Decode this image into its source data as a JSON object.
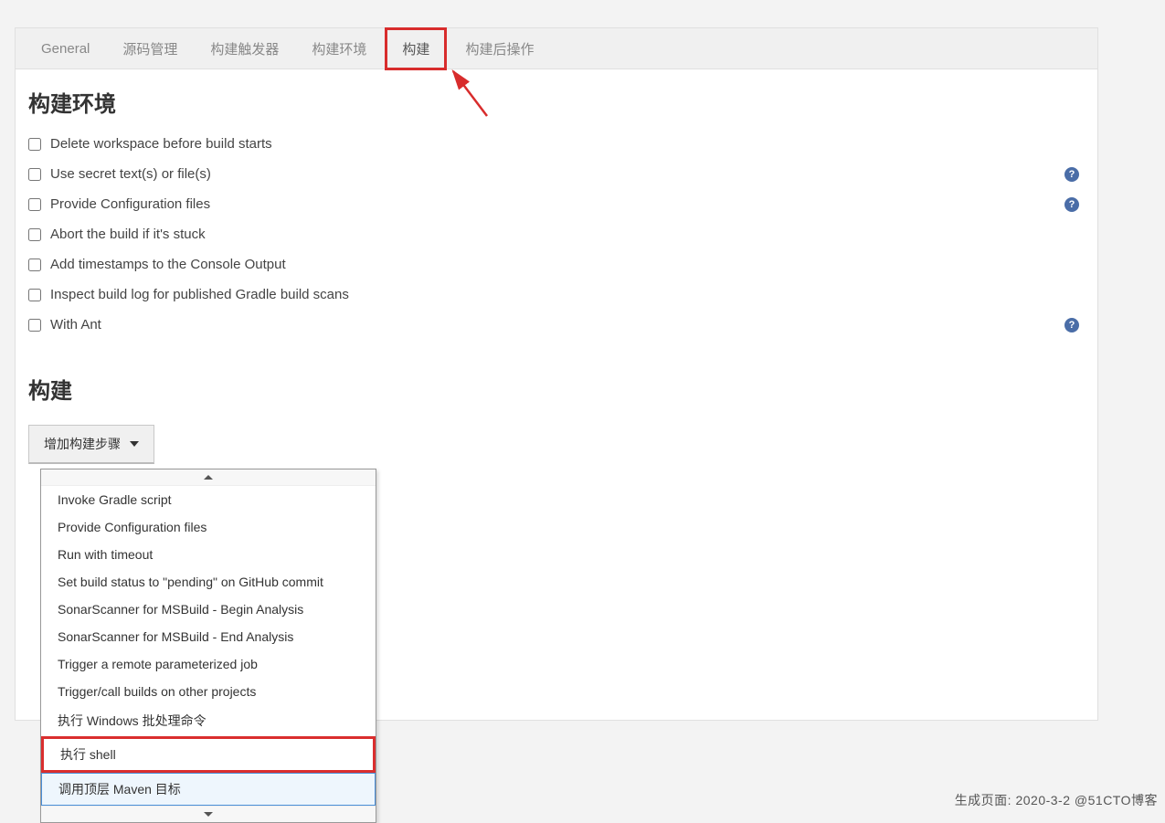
{
  "tabs": [
    "General",
    "源码管理",
    "构建触发器",
    "构建环境",
    "构建",
    "构建后操作"
  ],
  "active_tab_index": 4,
  "section_env": {
    "title": "构建环境",
    "items": [
      {
        "label": "Delete workspace before build starts",
        "help": false
      },
      {
        "label": "Use secret text(s) or file(s)",
        "help": true
      },
      {
        "label": "Provide Configuration files",
        "help": true
      },
      {
        "label": "Abort the build if it's stuck",
        "help": false
      },
      {
        "label": "Add timestamps to the Console Output",
        "help": false
      },
      {
        "label": "Inspect build log for published Gradle build scans",
        "help": false
      },
      {
        "label": "With Ant",
        "help": true
      }
    ]
  },
  "section_build": {
    "title": "构建",
    "button": "增加构建步骤"
  },
  "dropdown": {
    "items": [
      "Invoke Gradle script",
      "Provide Configuration files",
      "Run with timeout",
      "Set build status to \"pending\" on GitHub commit",
      "SonarScanner for MSBuild - Begin Analysis",
      "SonarScanner for MSBuild - End Analysis",
      "Trigger a remote parameterized job",
      "Trigger/call builds on other projects",
      "执行 Windows 批处理命令",
      "执行 shell",
      "调用顶层 Maven 目标"
    ],
    "highlighted_index": 9,
    "hovered_index": 10
  },
  "footer": {
    "label": "生成页面:",
    "date": "2020-3-2",
    "watermark": "@51CTO博客"
  }
}
